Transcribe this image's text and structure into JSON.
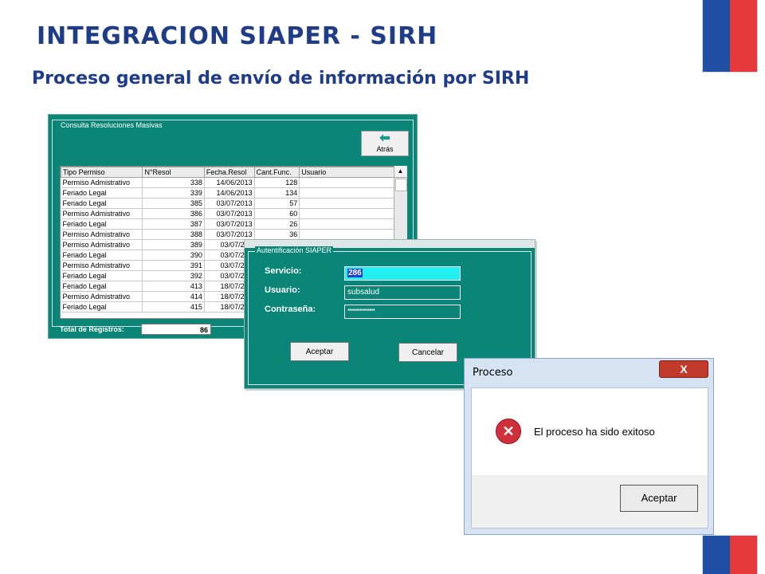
{
  "slide": {
    "title": "INTEGRACION SIAPER - SIRH",
    "subtitle": "Proceso general de envío de información por SIRH"
  },
  "consulta": {
    "legend": "Consulta Resoluciones Masivas",
    "back_button": "Atrás",
    "columns": [
      "Tipo Permiso",
      "N°Resol",
      "Fecha.Resol",
      "Cant.Func.",
      "Usuario"
    ],
    "rows": [
      [
        "Permiso Admistrativo",
        "338",
        "14/06/2013",
        "128",
        ""
      ],
      [
        "Feriado Legal",
        "339",
        "14/06/2013",
        "134",
        ""
      ],
      [
        "Feriado Legal",
        "385",
        "03/07/2013",
        "57",
        ""
      ],
      [
        "Permiso Admistrativo",
        "386",
        "03/07/2013",
        "60",
        ""
      ],
      [
        "Feriado Legal",
        "387",
        "03/07/2013",
        "26",
        ""
      ],
      [
        "Permiso Admistrativo",
        "388",
        "03/07/2013",
        "36",
        ""
      ],
      [
        "Permiso Admistrativo",
        "389",
        "03/07/201",
        "",
        ""
      ],
      [
        "Feriado Legal",
        "390",
        "03/07/201",
        "",
        ""
      ],
      [
        "Permiso Admistrativo",
        "391",
        "03/07/201",
        "",
        ""
      ],
      [
        "Feriado Legal",
        "392",
        "03/07/201",
        "",
        ""
      ],
      [
        "Feriado Legal",
        "413",
        "18/07/201",
        "",
        ""
      ],
      [
        "Permiso Admistrativo",
        "414",
        "18/07/201",
        "",
        ""
      ],
      [
        "Feriado Legal",
        "415",
        "18/07/201",
        "",
        ""
      ]
    ],
    "total_label": "Total de Registros:",
    "total_value": "86"
  },
  "auth": {
    "legend": "Autentificación SIAPER",
    "servicio_label": "Servicio:",
    "servicio_value": "286",
    "usuario_label": "Usuario:",
    "usuario_value": "subsalud",
    "password_label": "Contraseña:",
    "password_value": "****************",
    "accept_button": "Aceptar",
    "cancel_button": "Cancelar"
  },
  "proceso": {
    "title": "Proceso",
    "close_glyph": "X",
    "message": "El proceso ha sido exitoso",
    "accept_button": "Aceptar"
  },
  "colors": {
    "title_blue": "#1f3c88",
    "teal": "#0a8577",
    "flag_blue": "#1f4ea3",
    "flag_red": "#e5383b"
  },
  "icons": {
    "back": "arrow-left-icon",
    "error": "error-x-icon",
    "close": "close-icon"
  }
}
